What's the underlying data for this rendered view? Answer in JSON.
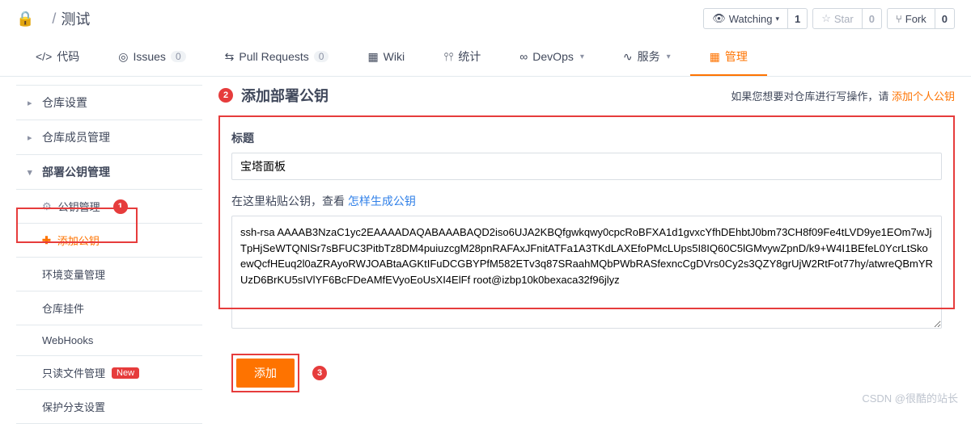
{
  "breadcrumb": {
    "owner": " ",
    "sep": "/",
    "repo": "测试"
  },
  "actions": {
    "watch": {
      "label": "Watching",
      "count": "1"
    },
    "star": {
      "label": "Star",
      "count": "0"
    },
    "fork": {
      "label": "Fork",
      "count": "0"
    }
  },
  "tabs": {
    "code": "代码",
    "issues": {
      "label": "Issues",
      "count": "0"
    },
    "pr": {
      "label": "Pull Requests",
      "count": "0"
    },
    "wiki": "Wiki",
    "stats": "统计",
    "devops": "DevOps",
    "services": "服务",
    "manage": "管理"
  },
  "sidebar": {
    "settings": "仓库设置",
    "members": "仓库成员管理",
    "deploy": "部署公钥管理",
    "keyManage": "公钥管理",
    "addKey": "添加公钥",
    "env": "环境变量管理",
    "hooks": "仓库挂件",
    "webhooks": "WebHooks",
    "readonly": "只读文件管理",
    "newBadge": "New",
    "branch": "保护分支设置"
  },
  "markers": {
    "m1": "1",
    "m2": "2",
    "m3": "3"
  },
  "main": {
    "title": "添加部署公钥",
    "hintPrefix": "如果您想要对仓库进行写操作，请 ",
    "hintLink": "添加个人公钥",
    "titleLabel": "标题",
    "titleValue": "宝塔面板",
    "pasteLabel": "在这里粘贴公钥，查看 ",
    "pasteLink": "怎样生成公钥",
    "keyValue": "ssh-rsa AAAAB3NzaC1yc2EAAAADAQABAAABAQD2iso6UJA2KBQfgwkqwy0cpcRoBFXA1d1gvxcYfhDEhbtJ0bm73CH8f09Fe4tLVD9ye1EOm7wJjTpHjSeWTQNlSr7sBFUC3PitbTz8DM4puiuzcgM28pnRAFAxJFnitATFa1A3TKdLAXEfoPMcLUps5I8IQ60C5lGMvywZpnD/k9+W4I1BEfeL0YcrLtSkoewQcfHEuq2l0aZRAyoRWJOABtaAGKtIFuDCGBYPfM582ETv3q87SRaahMQbPWbRASfexncCgDVrs0Cy2s3QZY8grUjW2RtFot77hy/atwreQBmYRUzD6BrKU5sIVlYF6BcFDeAMfEVyoEoUsXI4ElFf root@izbp10k0bexaca32f96jlyz",
    "submit": "添加"
  },
  "watermark": "CSDN @很酷的站长"
}
